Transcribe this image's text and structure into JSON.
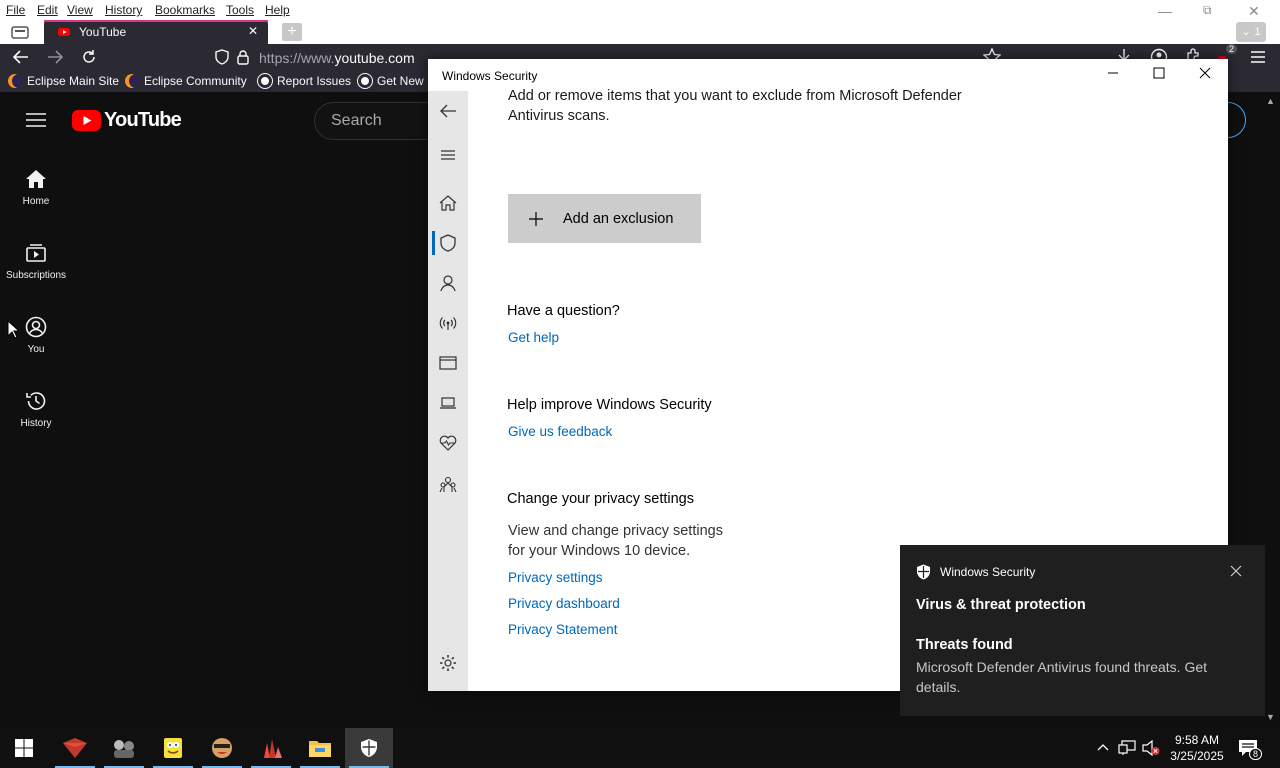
{
  "browser": {
    "menu": [
      "File",
      "Edit",
      "View",
      "History",
      "Bookmarks",
      "Tools",
      "Help"
    ],
    "tab_title": "YouTube",
    "url_prefix": "https://www.",
    "url_domain": "youtube.com",
    "bookmarks": [
      "Eclipse Main Site",
      "Eclipse Community",
      "Report Issues",
      "Get New I"
    ],
    "notification_count": "2",
    "tab_count": "1"
  },
  "youtube": {
    "logo_text": "YouTube",
    "search_placeholder": "Search",
    "sidebar": [
      {
        "label": "Home",
        "icon": "home-icon"
      },
      {
        "label": "Subscriptions",
        "icon": "subscriptions-icon"
      },
      {
        "label": "You",
        "icon": "you-icon"
      },
      {
        "label": "History",
        "icon": "history-icon"
      }
    ]
  },
  "windows_security": {
    "title": "Windows Security",
    "exclusion_description_line1": "Add or remove items that you want to exclude from Microsoft Defender",
    "exclusion_description_line2": "Antivirus scans.",
    "add_exclusion_label": "Add an exclusion",
    "question_heading": "Have a question?",
    "get_help_link": "Get help",
    "improve_heading": "Help improve Windows Security",
    "feedback_link": "Give us feedback",
    "privacy_heading": "Change your privacy settings",
    "privacy_text_line1": "View and change privacy settings",
    "privacy_text_line2": "for your Windows 10 device.",
    "privacy_links": [
      "Privacy settings",
      "Privacy dashboard",
      "Privacy Statement"
    ],
    "accent_color": "#0067b8"
  },
  "toast": {
    "app_name": "Windows Security",
    "title": "Virus & threat protection",
    "subtitle": "Threats found",
    "body_line1": "Microsoft Defender Antivirus found threats. Get",
    "body_line2": "details."
  },
  "taskbar": {
    "time": "9:58 AM",
    "date": "3/25/2025",
    "notification_count": "8"
  }
}
